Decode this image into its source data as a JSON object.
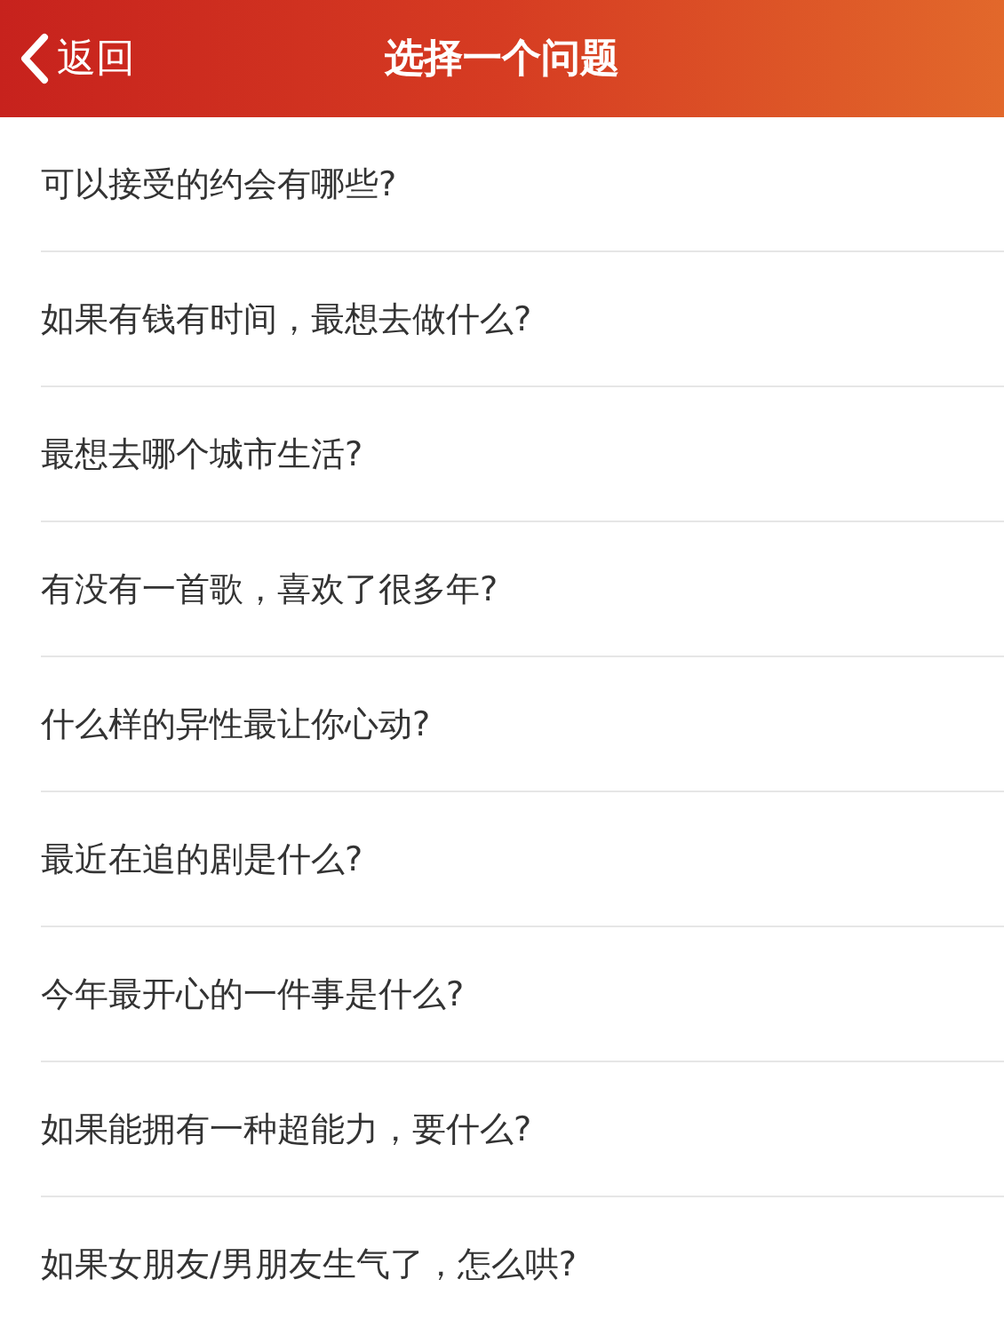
{
  "header": {
    "back": "返回",
    "title": "选择一个问题"
  },
  "questions": [
    "可以接受的约会有哪些?",
    "如果有钱有时间，最想去做什么?",
    "最想去哪个城市生活?",
    "有没有一首歌，喜欢了很多年?",
    "什么样的异性最让你心动?",
    "最近在追的剧是什么?",
    "今年最开心的一件事是什么?",
    "如果能拥有一种超能力，要什么?",
    "如果女朋友/男朋友生气了，怎么哄?"
  ]
}
